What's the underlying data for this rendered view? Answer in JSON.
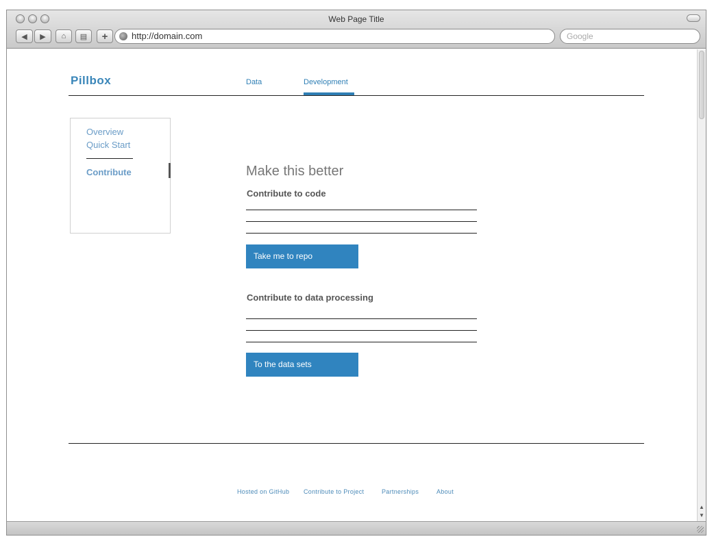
{
  "browser": {
    "window_title": "Web Page Title",
    "url": "http://domain.com",
    "search_placeholder": "Google"
  },
  "site": {
    "brand": "Pillbox",
    "nav": [
      {
        "label": "Data"
      },
      {
        "label": "Development",
        "active": true
      }
    ]
  },
  "sidebar": {
    "links": [
      "Overview",
      "Quick Start"
    ],
    "active": "Contribute"
  },
  "main": {
    "heading": "Make this better",
    "sections": [
      {
        "title": "Contribute to code",
        "button": "Take me to repo"
      },
      {
        "title": "Contribute to data  processing",
        "button": "To the data sets"
      }
    ]
  },
  "footer": {
    "links": [
      "Hosted on GitHub",
      "Contribute to Project",
      "Partnerships",
      "About"
    ]
  },
  "colors": {
    "accent": "#3084bf",
    "link": "#6a9cc7"
  }
}
